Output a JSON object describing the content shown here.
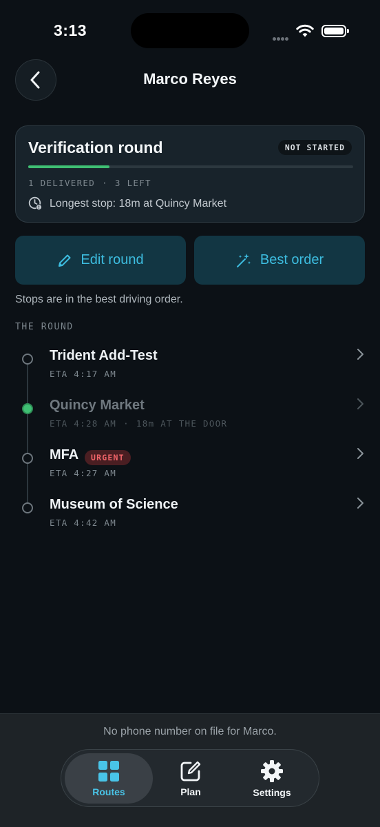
{
  "status_bar": {
    "time": "3:13"
  },
  "header": {
    "title": "Marco Reyes"
  },
  "summary": {
    "title": "Verification round",
    "status": "NOT STARTED",
    "progress": 0.25,
    "delivered": "1 DELIVERED",
    "left": "3 LEFT",
    "longest_stop": "Longest stop: 18m at Quincy Market"
  },
  "actions": {
    "edit_label": "Edit round",
    "best_order_label": "Best order"
  },
  "hint": "Stops are in the best driving order.",
  "section_label": "THE ROUND",
  "stops": [
    {
      "name": "Trident Add-Test",
      "eta": "ETA 4:17 AM",
      "extra": "",
      "badge": "",
      "delivered": false
    },
    {
      "name": "Quincy Market",
      "eta": "ETA 4:28 AM",
      "extra": "18m AT THE DOOR",
      "badge": "",
      "delivered": true
    },
    {
      "name": "MFA",
      "eta": "ETA 4:27 AM",
      "extra": "",
      "badge": "URGENT",
      "delivered": false
    },
    {
      "name": "Museum of Science",
      "eta": "ETA 4:42 AM",
      "extra": "",
      "badge": "",
      "delivered": false
    }
  ],
  "footer_note": "No phone number on file for Marco.",
  "tabs": [
    {
      "label": "Routes",
      "icon": "grid-icon",
      "active": true
    },
    {
      "label": "Plan",
      "icon": "edit-square-icon",
      "active": false
    },
    {
      "label": "Settings",
      "icon": "gear-icon",
      "active": false
    }
  ],
  "colors": {
    "accent": "#3dbde0",
    "success": "#3fbf73",
    "urgent": "#f2656a",
    "background": "#0c1116"
  }
}
